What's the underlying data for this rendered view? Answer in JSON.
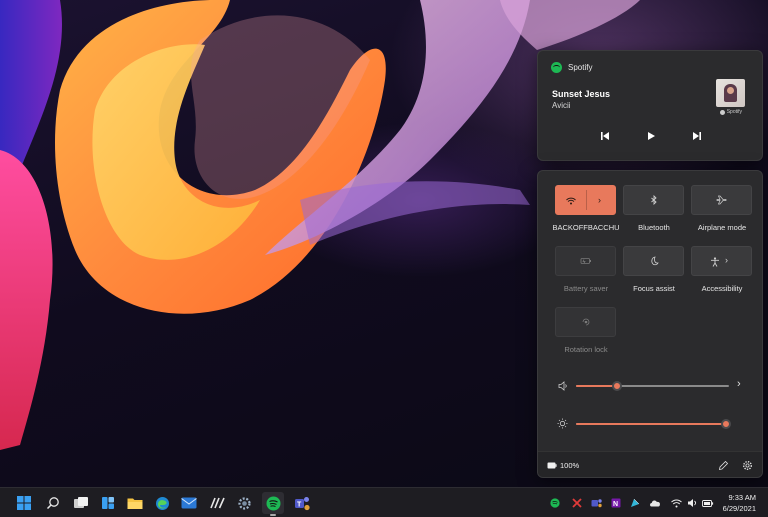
{
  "media": {
    "app_name": "Spotify",
    "track_title": "Sunset Jesus",
    "artist": "Avicii",
    "album_badge": "Spotify",
    "controls": [
      "previous-track",
      "play",
      "next-track"
    ]
  },
  "quick_settings": {
    "tiles": [
      {
        "label": "BACKOFFBACCHU",
        "icon": "wifi-icon",
        "state": "on",
        "has_expand": true
      },
      {
        "label": "Bluetooth",
        "icon": "bluetooth-icon",
        "state": "off"
      },
      {
        "label": "Airplane mode",
        "icon": "airplane-icon",
        "state": "off"
      },
      {
        "label": "Battery saver",
        "icon": "battery-saver-icon",
        "state": "disabled"
      },
      {
        "label": "Focus assist",
        "icon": "moon-icon",
        "state": "off"
      },
      {
        "label": "Accessibility",
        "icon": "accessibility-icon",
        "state": "off",
        "has_expand": true
      },
      {
        "label": "Rotation lock",
        "icon": "rotation-lock-icon",
        "state": "disabled"
      }
    ],
    "volume_level": 0.27,
    "brightness_level": 0.98,
    "battery_text": "100%"
  },
  "taskbar": {
    "apps": [
      "start-icon",
      "search-icon",
      "task-view-icon",
      "widgets-icon",
      "file-explorer-icon",
      "edge-icon",
      "mail-icon",
      "notion-icon",
      "settings-icon",
      "spotify-icon",
      "teams-icon"
    ],
    "tray": [
      "spotify-tray-icon",
      "pin-icon",
      "teams-tray-icon",
      "onenote-icon",
      "ink-icon",
      "cloud-icon",
      "wifi-tray-icon",
      "speaker-icon",
      "battery-icon"
    ],
    "time": "9:33 AM",
    "date": "6/29/2021"
  },
  "colors": {
    "accent": "#e8795c",
    "panel_bg": "#2b2b2d",
    "taskbar_bg": "#1e1d22"
  }
}
